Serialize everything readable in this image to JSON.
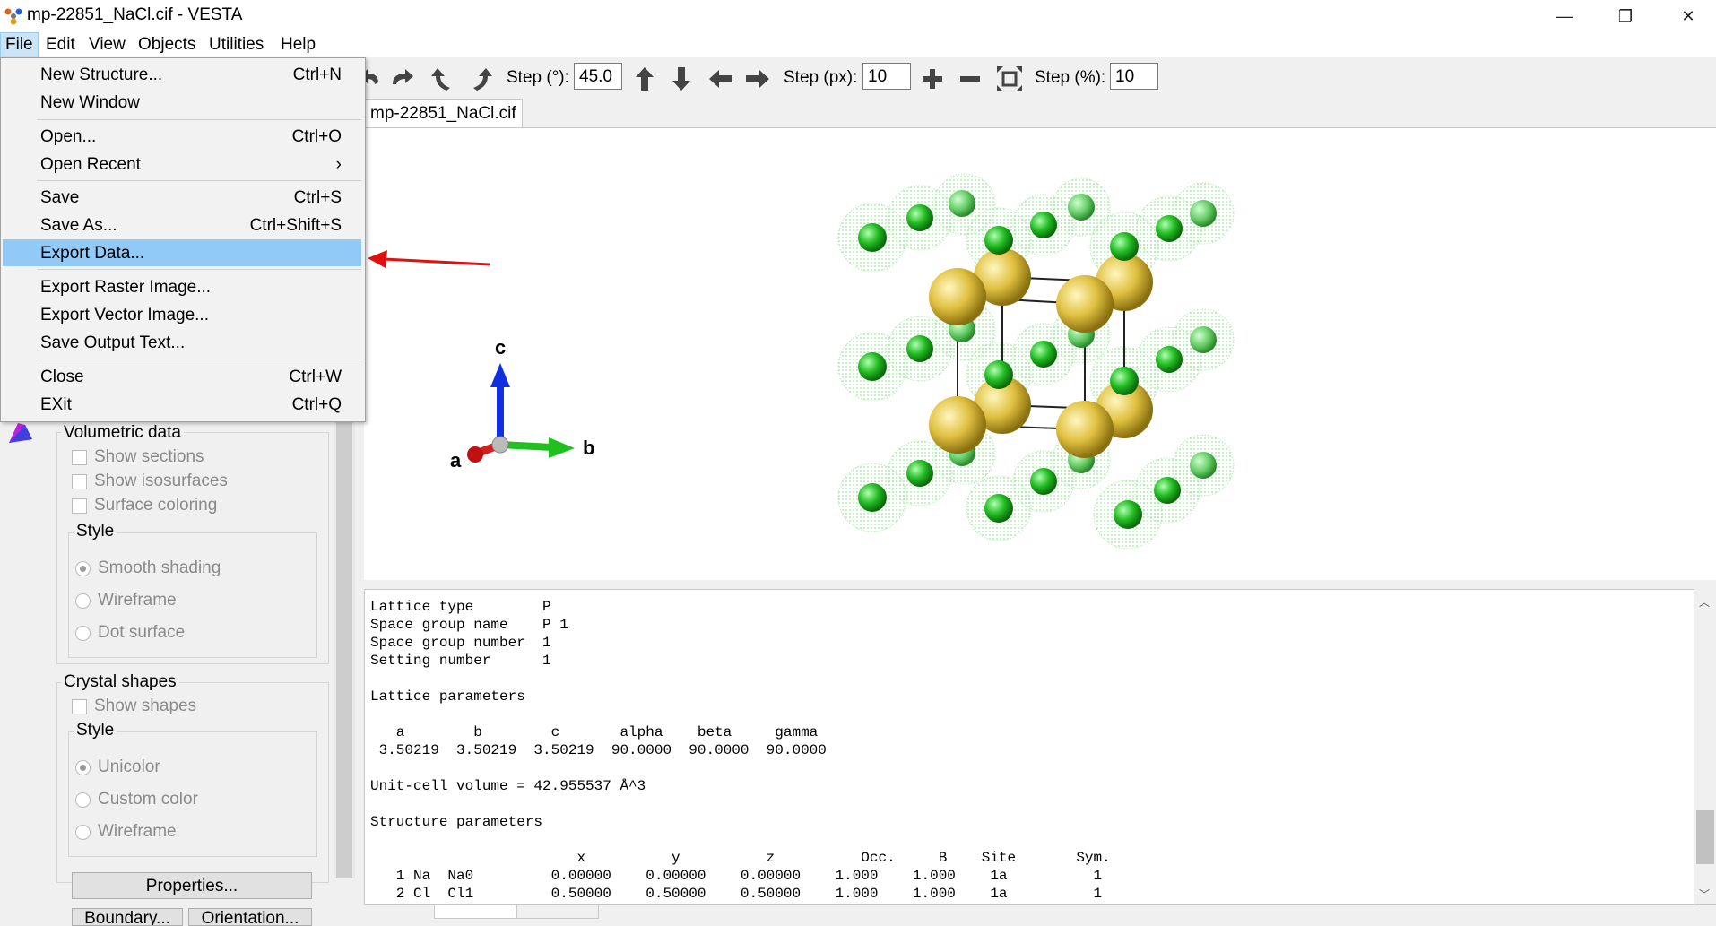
{
  "window": {
    "title": "mp-22851_NaCl.cif - VESTA",
    "minimize": "—",
    "restore": "❐",
    "close": "✕"
  },
  "menubar": {
    "items": [
      "File",
      "Edit",
      "View",
      "Objects",
      "Utilities",
      "Help"
    ],
    "active": "File"
  },
  "toolbar": {
    "step_deg_label": "Step (°):",
    "step_deg_value": "45.0",
    "step_px_label": "Step (px):",
    "step_px_value": "10",
    "step_pct_label": "Step (%):",
    "step_pct_value": "10"
  },
  "tab": {
    "label": "mp-22851_NaCl.cif"
  },
  "file_menu": {
    "items": [
      {
        "label": "New Structure...",
        "shortcut": "Ctrl+N"
      },
      {
        "label": "New Window",
        "shortcut": ""
      },
      {
        "label": "Open...",
        "shortcut": "Ctrl+O"
      },
      {
        "label": "Open Recent",
        "shortcut": "›"
      },
      {
        "label": "Save",
        "shortcut": "Ctrl+S"
      },
      {
        "label": "Save As...",
        "shortcut": "Ctrl+Shift+S"
      },
      {
        "label": "Export Data...",
        "shortcut": ""
      },
      {
        "label": "Export Raster Image...",
        "shortcut": ""
      },
      {
        "label": "Export Vector Image...",
        "shortcut": ""
      },
      {
        "label": "Save Output Text...",
        "shortcut": ""
      },
      {
        "label": "Close",
        "shortcut": "Ctrl+W"
      },
      {
        "label": "EXit",
        "shortcut": "Ctrl+Q"
      }
    ],
    "highlighted": "Export Data..."
  },
  "axes": {
    "a": "a",
    "b": "b",
    "c": "c"
  },
  "left_panel": {
    "volumetric": {
      "title": "Volumetric data",
      "show_sections": "Show sections",
      "show_isosurfaces": "Show isosurfaces",
      "surface_coloring": "Surface coloring",
      "style_title": "Style",
      "smooth": "Smooth shading",
      "wireframe": "Wireframe",
      "dot": "Dot surface"
    },
    "crystal": {
      "title": "Crystal shapes",
      "show_shapes": "Show shapes",
      "style_title": "Style",
      "unicolor": "Unicolor",
      "custom": "Custom color",
      "wireframe": "Wireframe"
    },
    "properties_button": "Properties...",
    "boundary_button": "Boundary...",
    "orientation_button": "Orientation..."
  },
  "output": {
    "lines": [
      "Lattice type        P",
      "Space group name    P 1",
      "Space group number  1",
      "Setting number      1",
      "",
      "Lattice parameters",
      "",
      "   a        b        c       alpha    beta     gamma",
      " 3.50219  3.50219  3.50219  90.0000  90.0000  90.0000",
      "",
      "Unit-cell volume = 42.955537 Å^3",
      "",
      "Structure parameters",
      "",
      "                        x          y          z          Occ.     B    Site       Sym.",
      "   1 Na  Na0         0.00000    0.00000    0.00000    1.000    1.000    1a          1",
      "   2 Cl  Cl1         0.50000    0.50000    0.50000    1.000    1.000    1a          1"
    ]
  },
  "colors": {
    "highlight": "#91c9f7",
    "na_atom": "#e0c040",
    "cl_atom": "#22bb22",
    "arrow": "#e01010"
  }
}
